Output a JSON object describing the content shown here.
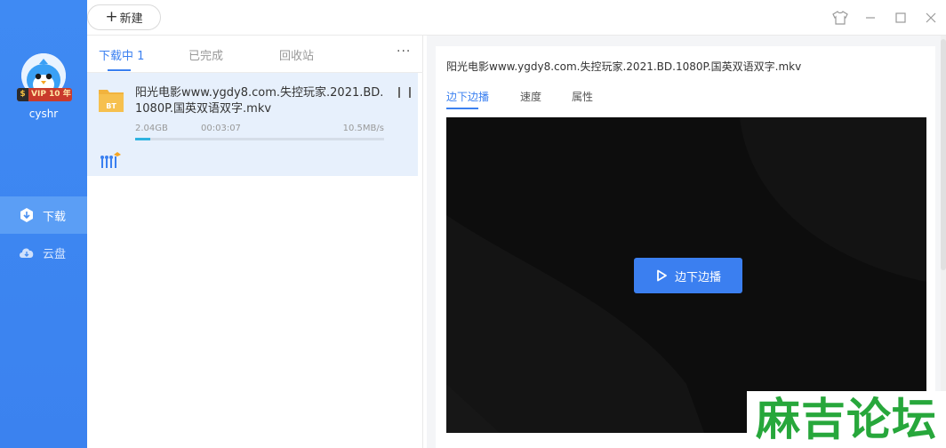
{
  "sidebar": {
    "username": "cyshr",
    "vip_badge": "VIP 10 年",
    "vip_symbol": "$",
    "nav": [
      {
        "label": "下载",
        "icon": "download-icon",
        "active": true
      },
      {
        "label": "云盘",
        "icon": "cloud-icon",
        "active": false
      }
    ],
    "accent": "#3f8af3"
  },
  "toolbar": {
    "new_label": "新建",
    "new_icon": "plus-icon",
    "window_controls": [
      "skin-icon",
      "minimize-icon",
      "maximize-icon",
      "close-icon"
    ]
  },
  "list": {
    "tabs": [
      {
        "label": "下载中 1",
        "active": true
      },
      {
        "label": "已完成",
        "active": false
      },
      {
        "label": "回收站",
        "active": false
      }
    ],
    "more_label": "···",
    "tasks": [
      {
        "name": "阳光电影www.ygdy8.com.失控玩家.2021.BD.1080P.国英双语双字.mkv",
        "type_badge": "BT",
        "size": "2.04GB",
        "remaining": "00:03:07",
        "speed": "10.5MB/s",
        "progress": 0.06
      }
    ]
  },
  "detail": {
    "title": "阳光电影www.ygdy8.com.失控玩家.2021.BD.1080P.国英双语双字.mkv",
    "tabs": [
      {
        "label": "边下边播",
        "active": true
      },
      {
        "label": "速度",
        "active": false
      },
      {
        "label": "属性",
        "active": false
      }
    ],
    "play_label": "边下边播"
  },
  "watermark": "麻吉论坛"
}
